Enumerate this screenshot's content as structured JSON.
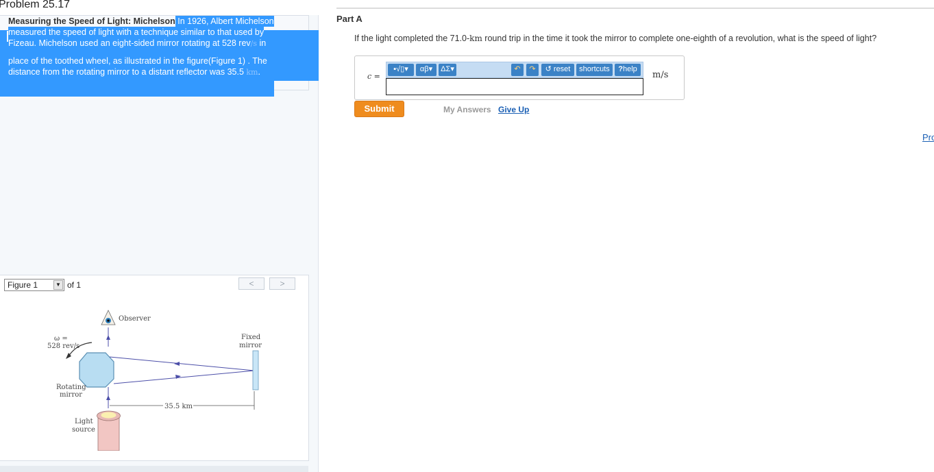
{
  "problem_title": "Problem 25.17",
  "intro": {
    "title": "Measuring the Speed of Light: Michelson",
    "line1": " In 1926, Albert Michelson",
    "line2": "measured the speed of light with a technique similar to that used by",
    "line3a": "Fizeau. Michelson used an eight-sided mirror rotating at 528 rev",
    "line3unit": "/s",
    "line3b": " in",
    "line4a": "place of the toothed wheel, as illustrated in the figure(",
    "line4link": "Figure 1",
    "line4b": ") . The",
    "line5a": "distance from the rotating mirror to a distant reflector was 35.5 ",
    "line5unit": "km",
    "line5b": "."
  },
  "figure": {
    "selector_value": "Figure 1",
    "of_label": "of 1",
    "prev_label": "<",
    "next_label": ">",
    "observer": "Observer",
    "omega_label": "ω =",
    "omega_value": "528 rev/s",
    "fixed": "Fixed",
    "mirror": "mirror",
    "rotating": "Rotating",
    "rotating_mirror": "mirror",
    "light": "Light",
    "source": "source",
    "distance": "35.5 km"
  },
  "part": {
    "label": "Part A",
    "question_a": "If the light completed the 71.0-",
    "question_km": "km",
    "question_b": " round trip in the time it took the mirror to complete one-eighth of a revolution, what is the speed of light?",
    "var_label": "c =",
    "unit": "m/s"
  },
  "toolbar": {
    "templates": "▪√▯",
    "greek": "αβ",
    "symbols": "ΔΣ",
    "undo": "↶",
    "redo": "↷",
    "reset": "reset",
    "shortcuts": "shortcuts",
    "help": "help"
  },
  "actions": {
    "submit": "Submit",
    "my_answers": "My Answers",
    "give_up": "Give Up"
  },
  "edge_link": "Pro",
  "colors": {
    "selection": "#3399ff",
    "submit": "#ef8c1e",
    "toolbar_btn": "#3b82c6",
    "link": "#1a5fb4"
  }
}
